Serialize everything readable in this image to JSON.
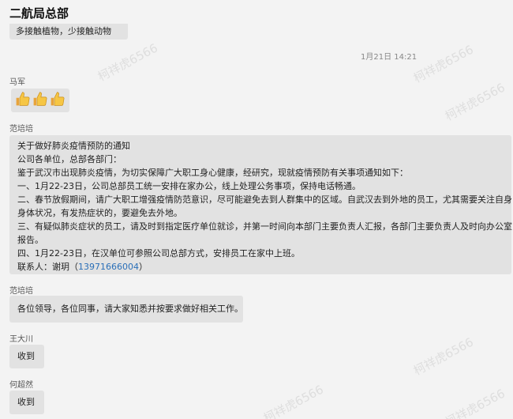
{
  "header": {
    "title": "二航局总部"
  },
  "messages": {
    "top_text": "多接触植物，少接触动物",
    "timestamp": "1月21日 14:21",
    "thumbs": {
      "sender": "马军",
      "emoji": "thumbs-up-icon",
      "count": 3
    },
    "notice": {
      "sender": "范培培",
      "lines": [
        "关于做好肺炎疫情预防的通知",
        "公司各单位，总部各部门：",
        "鉴于武汉市出现肺炎疫情，为切实保障广大职工身心健康，经研究，现就疫情预防有关事项通知如下：",
        "一、1月22-23日，公司总部员工统一安排在家办公，线上处理公务事项，保持电话畅通。",
        "二、春节放假期间，请广大职工增强疫情防范意识，尽可能避免去到人群集中的区域。自武汉去到外地的员工，尤其需要关注自身",
        "身体状况，有发热症状的，要避免去外地。",
        "三、有疑似肺炎症状的员工，请及时到指定医疗单位就诊，并第一时间向本部门主要负责人汇报，各部门主要负责人及时向办公室",
        "报告。",
        "四、1月22-23日，在汉单位可参照公司总部方式，安排员工在家中上班。"
      ],
      "contact_label": "联系人：谢玥（",
      "contact_phone": "13971666004",
      "contact_suffix": "）"
    },
    "reply1": {
      "sender": "范培培",
      "text": "各位领导，各位同事，请大家知悉并按要求做好相关工作。"
    },
    "ack1": {
      "sender": "王大川",
      "text": "收到"
    },
    "ack2": {
      "sender": "何超然",
      "text": "收到"
    }
  },
  "watermark": {
    "text": "柯祥虎6566"
  }
}
